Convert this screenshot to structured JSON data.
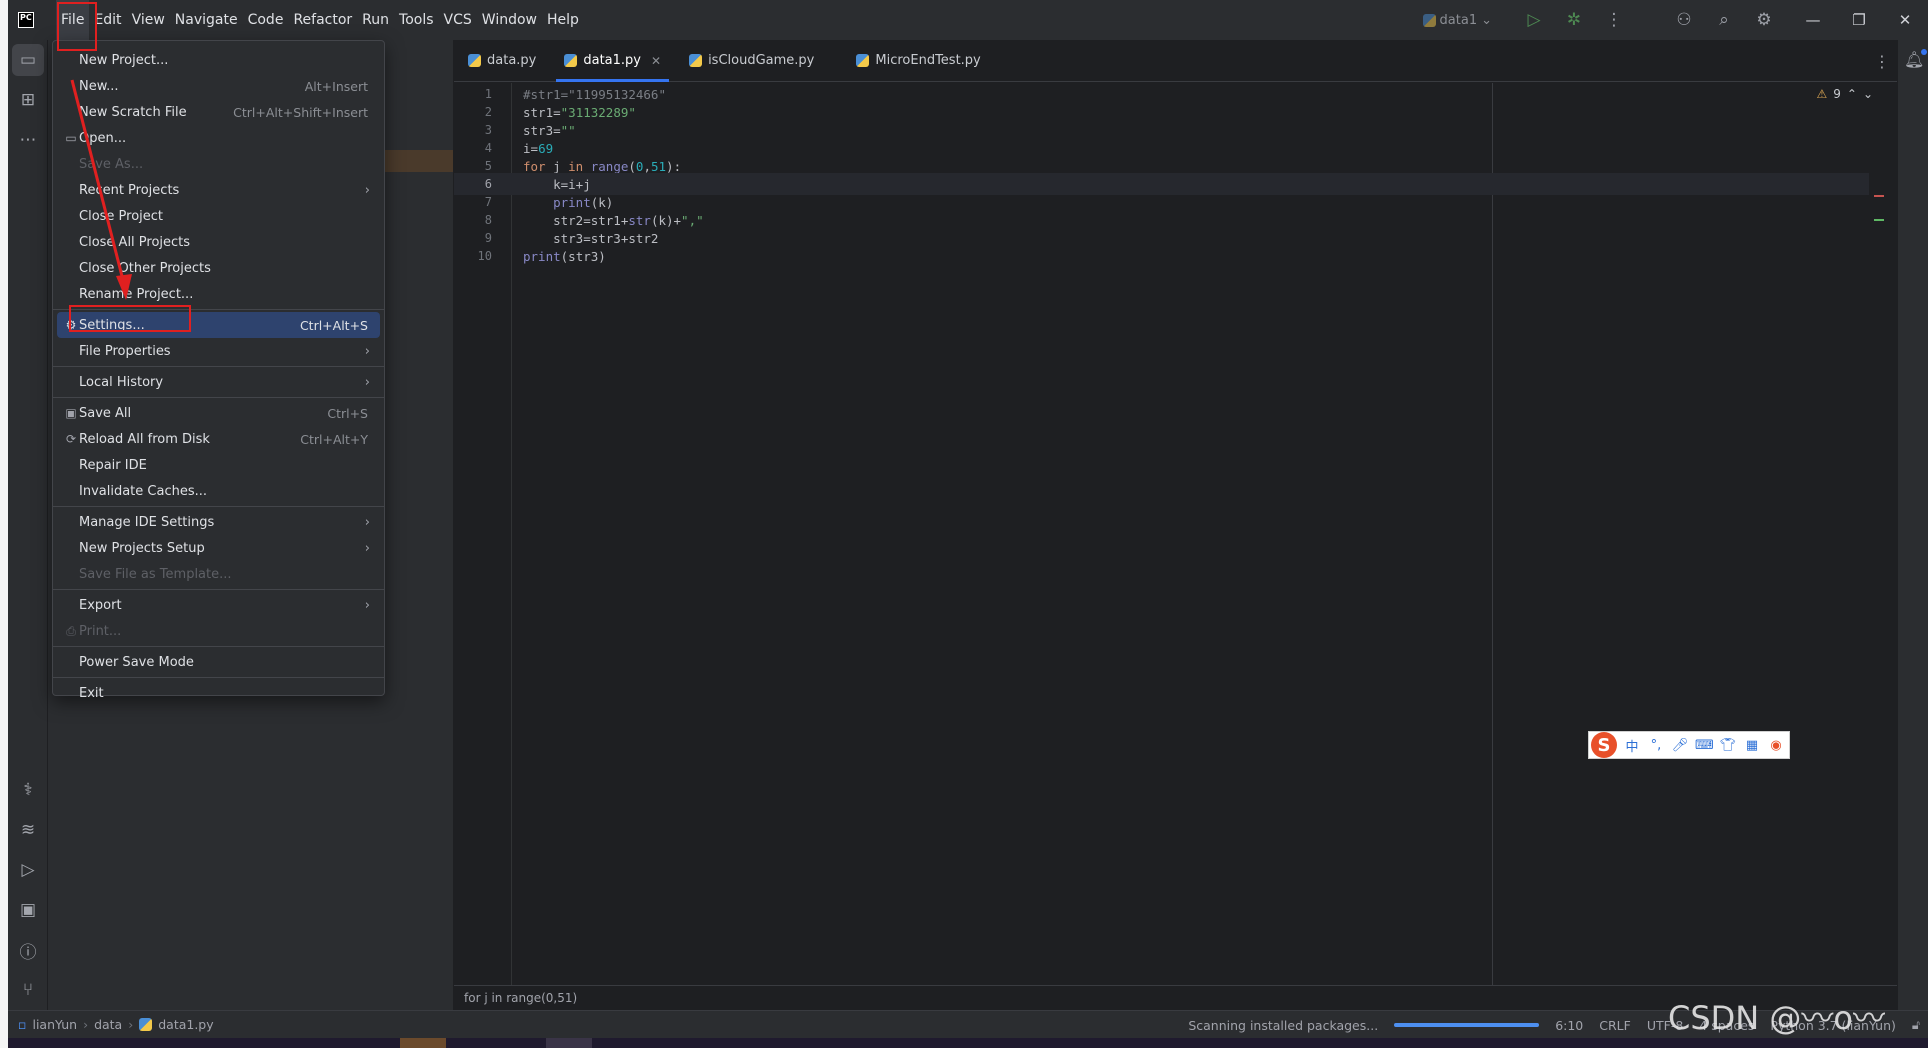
{
  "menubar": {
    "items": [
      {
        "label": "File"
      },
      {
        "label": "Edit"
      },
      {
        "label": "View"
      },
      {
        "label": "Navigate"
      },
      {
        "label": "Code"
      },
      {
        "label": "Refactor"
      },
      {
        "label": "Run"
      },
      {
        "label": "Tools"
      },
      {
        "label": "VCS"
      },
      {
        "label": "Window"
      },
      {
        "label": "Help"
      }
    ],
    "logo_text": "PC"
  },
  "toolbar": {
    "run_config": "data1"
  },
  "tabs": [
    {
      "label": "data.py"
    },
    {
      "label": "data1.py"
    },
    {
      "label": "isCloudGame.py"
    },
    {
      "label": "MicroEndTest.py"
    }
  ],
  "file_menu": {
    "items": [
      {
        "label": "New Project...",
        "shortcut": ""
      },
      {
        "label": "New...",
        "shortcut": "Alt+Insert"
      },
      {
        "label": "New Scratch File",
        "shortcut": "Ctrl+Alt+Shift+Insert"
      },
      {
        "label": "Open...",
        "shortcut": ""
      },
      {
        "label": "Save As...",
        "shortcut": ""
      },
      {
        "label": "Recent Projects",
        "shortcut": ""
      },
      {
        "label": "Close Project",
        "shortcut": ""
      },
      {
        "label": "Close All Projects",
        "shortcut": ""
      },
      {
        "label": "Close Other Projects",
        "shortcut": ""
      },
      {
        "label": "Rename Project...",
        "shortcut": ""
      },
      {
        "label": "Settings...",
        "shortcut": "Ctrl+Alt+S"
      },
      {
        "label": "File Properties",
        "shortcut": ""
      },
      {
        "label": "Local History",
        "shortcut": ""
      },
      {
        "label": "Save All",
        "shortcut": "Ctrl+S"
      },
      {
        "label": "Reload All from Disk",
        "shortcut": "Ctrl+Alt+Y"
      },
      {
        "label": "Repair IDE",
        "shortcut": ""
      },
      {
        "label": "Invalidate Caches...",
        "shortcut": ""
      },
      {
        "label": "Manage IDE Settings",
        "shortcut": ""
      },
      {
        "label": "New Projects Setup",
        "shortcut": ""
      },
      {
        "label": "Save File as Template...",
        "shortcut": ""
      },
      {
        "label": "Export",
        "shortcut": ""
      },
      {
        "label": "Print...",
        "shortcut": ""
      },
      {
        "label": "Power Save Mode",
        "shortcut": ""
      },
      {
        "label": "Exit",
        "shortcut": ""
      }
    ]
  },
  "editor": {
    "line_numbers": [
      "1",
      "2",
      "3",
      "4",
      "5",
      "6",
      "7",
      "8",
      "9",
      "10"
    ],
    "current_line": 6,
    "warnings": "9",
    "breadcrumb": "for j in range(0,51)"
  },
  "statusbar": {
    "project": "lianYun",
    "folder": "data",
    "file": "data1.py",
    "task": "Scanning installed packages...",
    "progress": 1.0,
    "position": "6:10",
    "line_sep": "CRLF",
    "encoding": "UTF-8",
    "indent": "4 spaces",
    "interpreter": "Python 3.7 (lianYun)"
  },
  "watermark": "CSDN @〰o〰",
  "colors": {
    "accent": "#3574f0",
    "highlight": "#2e436e",
    "annotation": "#e02020",
    "keyword": "#cf8e6d",
    "string": "#6aab73",
    "number": "#2aacb8"
  }
}
